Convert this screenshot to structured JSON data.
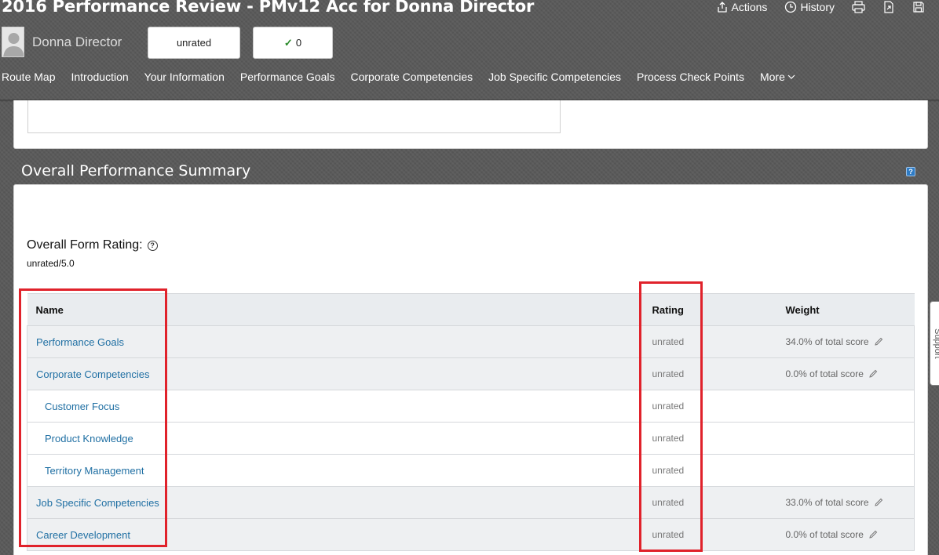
{
  "header": {
    "form_title": "2016 Performance Review - PMv12 Acc for Donna Director",
    "employee_name": "Donna Director",
    "rating_pill": "unrated",
    "check_count": "0",
    "actions": [
      {
        "label": "Actions",
        "icon": "share-icon"
      },
      {
        "label": "History",
        "icon": "clock-icon"
      }
    ],
    "icon_buttons": [
      "print-icon",
      "export-icon",
      "save-icon"
    ]
  },
  "nav": {
    "items": [
      "Route Map",
      "Introduction",
      "Your Information",
      "Performance Goals",
      "Corporate Competencies",
      "Job Specific Competencies",
      "Process Check Points",
      "More"
    ]
  },
  "summary": {
    "section_title": "Overall Performance Summary",
    "help_icon": "help-icon",
    "overall_label": "Overall Form Rating:",
    "overall_value": "unrated/5.0",
    "columns": {
      "name": "Name",
      "rating": "Rating",
      "weight": "Weight"
    },
    "rows": [
      {
        "name": "Performance Goals",
        "rating": "unrated",
        "weight": "34.0% of total score",
        "child": false,
        "shaded": true
      },
      {
        "name": "Corporate Competencies",
        "rating": "unrated",
        "weight": "0.0% of total score",
        "child": false,
        "shaded": true
      },
      {
        "name": "Customer Focus",
        "rating": "unrated",
        "weight": "",
        "child": true,
        "shaded": false
      },
      {
        "name": "Product Knowledge",
        "rating": "unrated",
        "weight": "",
        "child": true,
        "shaded": false
      },
      {
        "name": "Territory Management",
        "rating": "unrated",
        "weight": "",
        "child": true,
        "shaded": false
      },
      {
        "name": "Job Specific Competencies",
        "rating": "unrated",
        "weight": "33.0% of total score",
        "child": false,
        "shaded": true
      },
      {
        "name": "Career Development",
        "rating": "unrated",
        "weight": "0.0% of total score",
        "child": false,
        "shaded": true
      }
    ]
  },
  "support_tab": "Support",
  "colors": {
    "link": "#1f6fa3",
    "highlight": "#e0222b",
    "header_bg": "#5a5a5a"
  }
}
